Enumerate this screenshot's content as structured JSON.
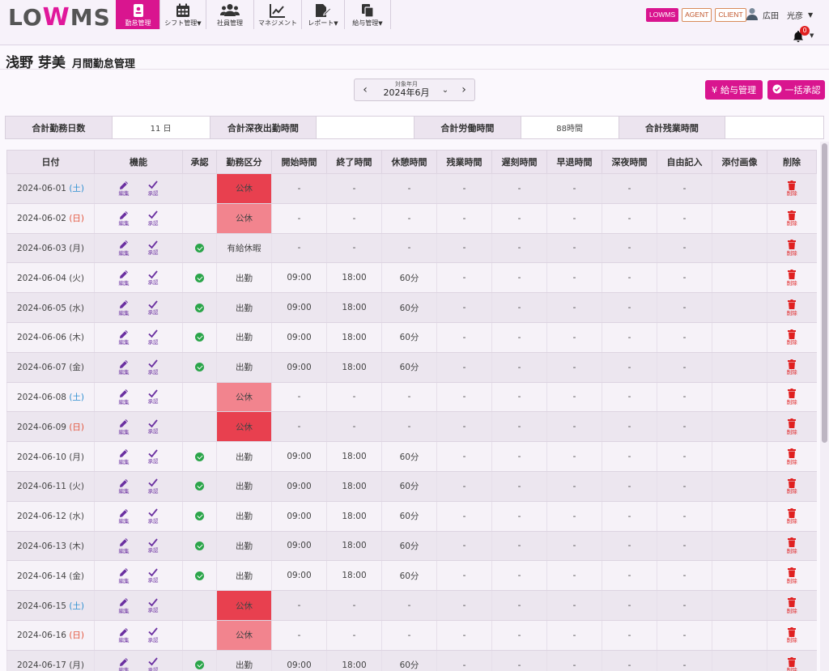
{
  "app": {
    "logo_text_1": "LO",
    "logo_text_2": "W",
    "logo_text_3": "MS"
  },
  "nav": [
    {
      "label": "勤怠管理",
      "icon": "id-card-icon",
      "active": true
    },
    {
      "label": "シフト管理",
      "icon": "calendar-icon",
      "dropdown": true
    },
    {
      "label": "社員管理",
      "icon": "users-icon"
    },
    {
      "label": "マネジメント",
      "icon": "chart-line-icon"
    },
    {
      "label": "レポート",
      "icon": "file-edit-icon",
      "dropdown": true
    },
    {
      "label": "給与管理",
      "icon": "copy-icon",
      "dropdown": true
    }
  ],
  "header": {
    "tags": [
      "LOWMS",
      "AGENT",
      "CLIENT"
    ],
    "user_name": "広田　光彦",
    "notification_count": "0"
  },
  "page": {
    "employee_name": "浅野 芽美",
    "title": "月間勤怠管理"
  },
  "month_picker": {
    "label": "対象年月",
    "value": "2024年6月"
  },
  "buttons": {
    "salary": "給与管理",
    "approve_all": "一括承認",
    "salary_icon": "¥"
  },
  "summary": [
    {
      "label": "合計勤務日数",
      "value": "11 日"
    },
    {
      "label": "合計深夜出勤時間",
      "value": ""
    },
    {
      "label": "合計労働時間",
      "value": "88時間"
    },
    {
      "label": "合計残業時間",
      "value": ""
    }
  ],
  "table": {
    "columns": [
      "日付",
      "機能",
      "承認",
      "勤務区分",
      "開始時間",
      "終了時間",
      "休憩時間",
      "残業時間",
      "遅刻時間",
      "早退時間",
      "深夜時間",
      "自由記入",
      "添付画像",
      "削除"
    ],
    "edit_label": "編集",
    "approve_label": "承認",
    "delete_label": "削除",
    "rows": [
      {
        "date": "2024-06-01",
        "dow": "(土)",
        "dow_type": "sat",
        "approved": false,
        "kubun": "公休",
        "kubun_style": "dark",
        "start": "-",
        "end": "-",
        "break": "-",
        "overtime": "-",
        "late": "-",
        "early": "-",
        "night": "-",
        "memo": "-"
      },
      {
        "date": "2024-06-02",
        "dow": "(日)",
        "dow_type": "sun",
        "approved": false,
        "kubun": "公休",
        "kubun_style": "light",
        "start": "-",
        "end": "-",
        "break": "-",
        "overtime": "-",
        "late": "-",
        "early": "-",
        "night": "-",
        "memo": "-"
      },
      {
        "date": "2024-06-03",
        "dow": "(月)",
        "dow_type": "weekday",
        "approved": true,
        "kubun": "有給休暇",
        "kubun_style": "none",
        "start": "-",
        "end": "-",
        "break": "-",
        "overtime": "-",
        "late": "-",
        "early": "-",
        "night": "-",
        "memo": "-"
      },
      {
        "date": "2024-06-04",
        "dow": "(火)",
        "dow_type": "weekday",
        "approved": true,
        "kubun": "出勤",
        "kubun_style": "none",
        "start": "09:00",
        "end": "18:00",
        "break": "60分",
        "overtime": "-",
        "late": "-",
        "early": "-",
        "night": "-",
        "memo": "-"
      },
      {
        "date": "2024-06-05",
        "dow": "(水)",
        "dow_type": "weekday",
        "approved": true,
        "kubun": "出勤",
        "kubun_style": "none",
        "start": "09:00",
        "end": "18:00",
        "break": "60分",
        "overtime": "-",
        "late": "-",
        "early": "-",
        "night": "-",
        "memo": "-"
      },
      {
        "date": "2024-06-06",
        "dow": "(木)",
        "dow_type": "weekday",
        "approved": true,
        "kubun": "出勤",
        "kubun_style": "none",
        "start": "09:00",
        "end": "18:00",
        "break": "60分",
        "overtime": "-",
        "late": "-",
        "early": "-",
        "night": "-",
        "memo": "-"
      },
      {
        "date": "2024-06-07",
        "dow": "(金)",
        "dow_type": "weekday",
        "approved": true,
        "kubun": "出勤",
        "kubun_style": "none",
        "start": "09:00",
        "end": "18:00",
        "break": "60分",
        "overtime": "-",
        "late": "-",
        "early": "-",
        "night": "-",
        "memo": "-"
      },
      {
        "date": "2024-06-08",
        "dow": "(土)",
        "dow_type": "sat",
        "approved": false,
        "kubun": "公休",
        "kubun_style": "light",
        "start": "-",
        "end": "-",
        "break": "-",
        "overtime": "-",
        "late": "-",
        "early": "-",
        "night": "-",
        "memo": "-"
      },
      {
        "date": "2024-06-09",
        "dow": "(日)",
        "dow_type": "sun",
        "approved": false,
        "kubun": "公休",
        "kubun_style": "dark",
        "start": "-",
        "end": "-",
        "break": "-",
        "overtime": "-",
        "late": "-",
        "early": "-",
        "night": "-",
        "memo": "-"
      },
      {
        "date": "2024-06-10",
        "dow": "(月)",
        "dow_type": "weekday",
        "approved": true,
        "kubun": "出勤",
        "kubun_style": "none",
        "start": "09:00",
        "end": "18:00",
        "break": "60分",
        "overtime": "-",
        "late": "-",
        "early": "-",
        "night": "-",
        "memo": "-"
      },
      {
        "date": "2024-06-11",
        "dow": "(火)",
        "dow_type": "weekday",
        "approved": true,
        "kubun": "出勤",
        "kubun_style": "none",
        "start": "09:00",
        "end": "18:00",
        "break": "60分",
        "overtime": "-",
        "late": "-",
        "early": "-",
        "night": "-",
        "memo": "-"
      },
      {
        "date": "2024-06-12",
        "dow": "(水)",
        "dow_type": "weekday",
        "approved": true,
        "kubun": "出勤",
        "kubun_style": "none",
        "start": "09:00",
        "end": "18:00",
        "break": "60分",
        "overtime": "-",
        "late": "-",
        "early": "-",
        "night": "-",
        "memo": "-"
      },
      {
        "date": "2024-06-13",
        "dow": "(木)",
        "dow_type": "weekday",
        "approved": true,
        "kubun": "出勤",
        "kubun_style": "none",
        "start": "09:00",
        "end": "18:00",
        "break": "60分",
        "overtime": "-",
        "late": "-",
        "early": "-",
        "night": "-",
        "memo": "-"
      },
      {
        "date": "2024-06-14",
        "dow": "(金)",
        "dow_type": "weekday",
        "approved": true,
        "kubun": "出勤",
        "kubun_style": "none",
        "start": "09:00",
        "end": "18:00",
        "break": "60分",
        "overtime": "-",
        "late": "-",
        "early": "-",
        "night": "-",
        "memo": "-"
      },
      {
        "date": "2024-06-15",
        "dow": "(土)",
        "dow_type": "sat",
        "approved": false,
        "kubun": "公休",
        "kubun_style": "dark",
        "start": "-",
        "end": "-",
        "break": "-",
        "overtime": "-",
        "late": "-",
        "early": "-",
        "night": "-",
        "memo": "-"
      },
      {
        "date": "2024-06-16",
        "dow": "(日)",
        "dow_type": "sun",
        "approved": false,
        "kubun": "公休",
        "kubun_style": "light",
        "start": "-",
        "end": "-",
        "break": "-",
        "overtime": "-",
        "late": "-",
        "early": "-",
        "night": "-",
        "memo": "-"
      },
      {
        "date": "2024-06-17",
        "dow": "(月)",
        "dow_type": "weekday",
        "approved": true,
        "kubun": "出勤",
        "kubun_style": "none",
        "start": "09:00",
        "end": "18:00",
        "break": "60分",
        "overtime": "-",
        "late": "-",
        "early": "-",
        "night": "-",
        "memo": "-"
      }
    ]
  },
  "colors": {
    "brand": "#d9158f",
    "kubun_dark": "#e8404f",
    "kubun_light": "#f2848e",
    "approved": "#2ba54a",
    "delete": "#e02020",
    "saturday": "#2d8fd1",
    "sunday": "#e3543b"
  }
}
